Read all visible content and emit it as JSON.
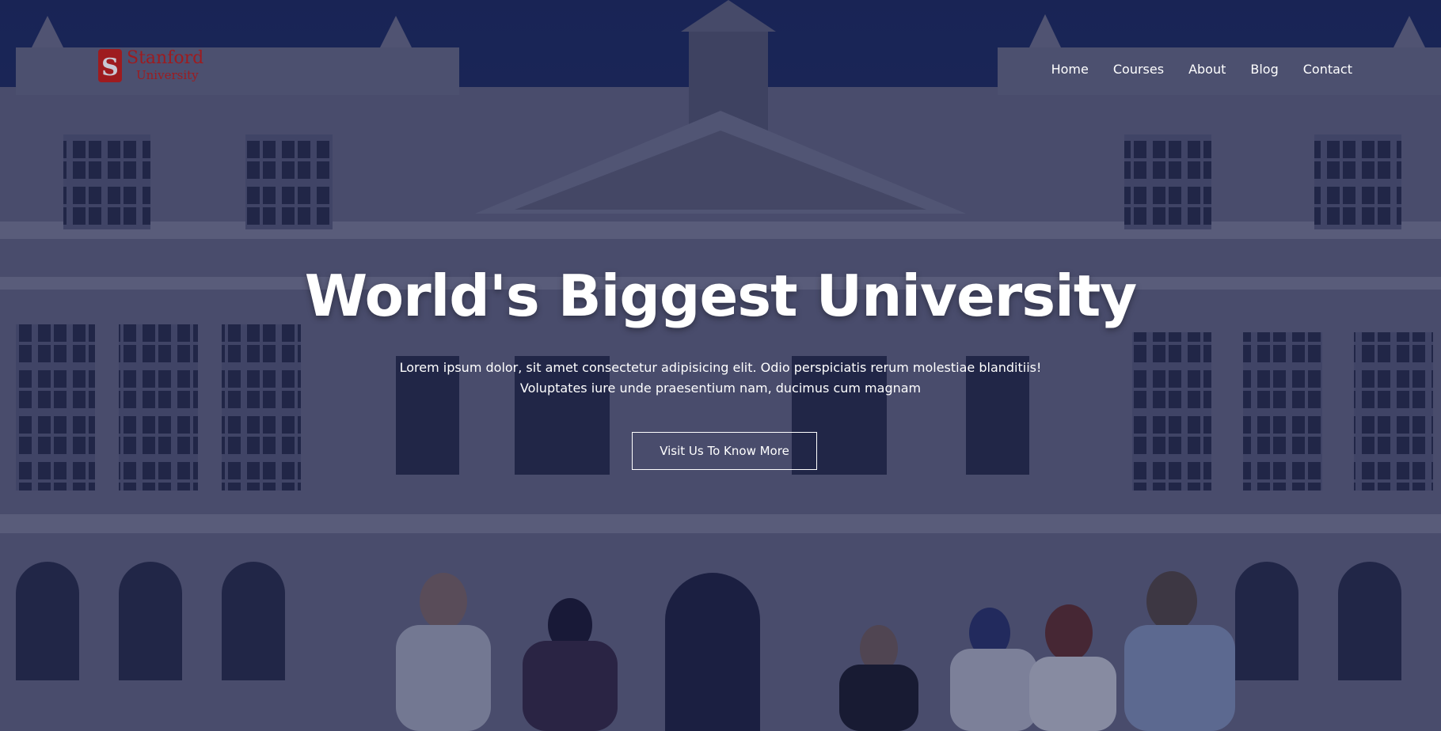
{
  "brand": {
    "name_top": "Stanford",
    "name_bottom": "University",
    "emblem_letter": "S",
    "color": "#9e1b1f"
  },
  "nav": {
    "items": [
      {
        "label": "Home"
      },
      {
        "label": "Courses"
      },
      {
        "label": "About"
      },
      {
        "label": "Blog"
      },
      {
        "label": "Contact"
      }
    ]
  },
  "hero": {
    "title": "World's Biggest University",
    "text_line1": "Lorem ipsum dolor, sit amet consectetur adipisicing elit. Odio perspiciatis rerum molestiae blanditiis!",
    "text_line2": "Voluptates iure unde praesentium nam, ducimus cum magnam",
    "cta_label": "Visit Us To Know More",
    "background_image": "university-building-with-students",
    "overlay_color": "#161c42"
  }
}
